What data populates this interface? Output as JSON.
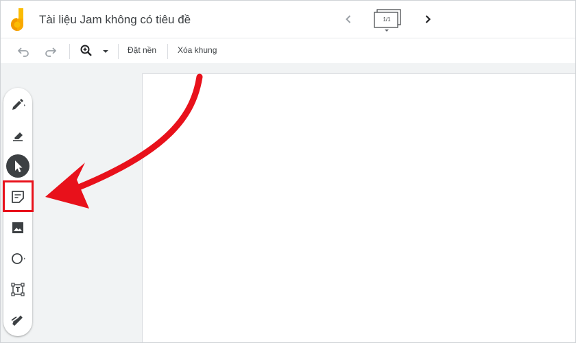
{
  "app": {
    "title": "Tài liệu Jam không có tiêu đề",
    "frame_counter": "1/1"
  },
  "toolbar": {
    "set_background_label": "Đặt nền",
    "clear_frame_label": "Xóa khung"
  },
  "palette": {
    "tools": [
      "pen",
      "eraser",
      "select",
      "sticky-note",
      "image",
      "circle",
      "text-box",
      "laser"
    ],
    "active_tool": "select",
    "highlighted_tool": "sticky-note"
  },
  "colors": {
    "annotation": "#e8111b",
    "active_tool_bg": "#3c4043",
    "workspace_bg": "#f1f3f4",
    "logo_yellow": "#fbbc04",
    "logo_orange": "#f29900"
  }
}
